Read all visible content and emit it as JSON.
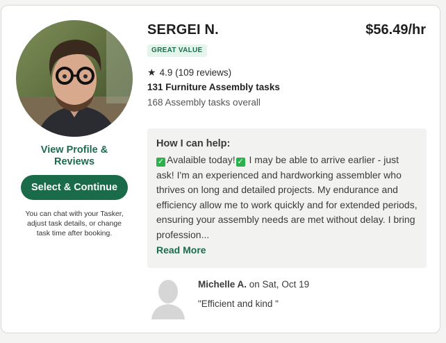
{
  "tasker": {
    "name": "SERGEI N.",
    "rate": "$56.49/hr",
    "badge": "GREAT VALUE",
    "rating": "4.9 (109 reviews)",
    "category_tasks": "131 Furniture Assembly tasks",
    "overall_tasks": "168 Assembly tasks overall"
  },
  "left": {
    "view_profile_line1": "View Profile &",
    "view_profile_line2": "Reviews",
    "select_button": "Select & Continue",
    "helper_text": "You can chat with your Tasker, adjust task details, or change task time after booking."
  },
  "help": {
    "title": "How I can help:",
    "segment1": "Avalaible today!",
    "segment2": " I may be able to arrive earlier - just ask! I'm an experienced and hardworking assembler who thrives on long and detailed projects. My endurance and efficiency allow me to work quickly and for extended periods, ensuring your assembly needs are met without delay. I bring profession...",
    "read_more": "Read More"
  },
  "review": {
    "reviewer": "Michelle A.",
    "date": " on Sat, Oct 19",
    "text": "\"Efficient and kind \""
  },
  "icons": {
    "star": "star-icon",
    "check": "check-mark-icon",
    "avatar_placeholder": "person-silhouette-icon"
  },
  "colors": {
    "brand_green": "#1a6b4a",
    "badge_bg": "#e4f6ec",
    "check_green": "#2bb24c"
  }
}
